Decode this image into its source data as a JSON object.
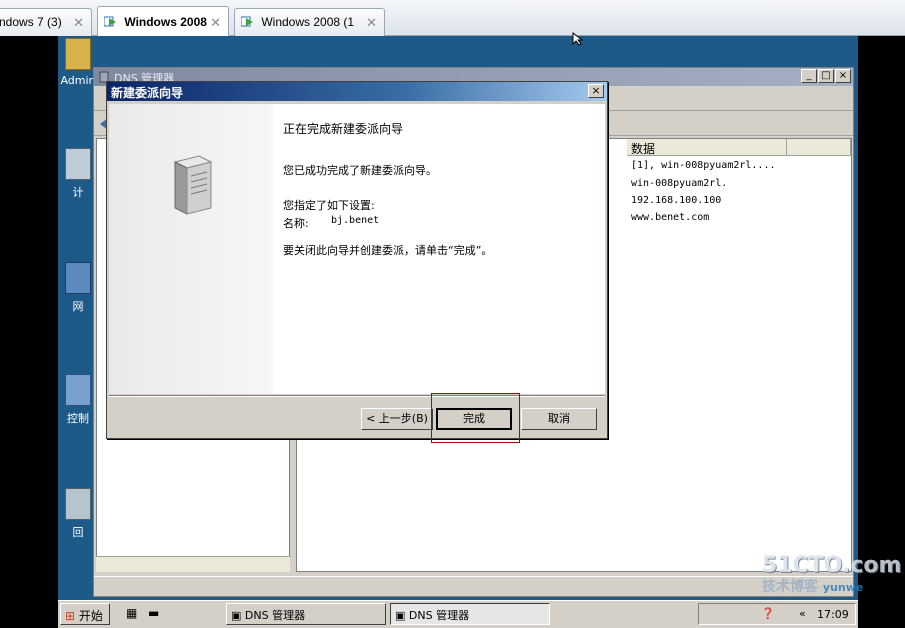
{
  "vm_tabs": [
    {
      "label": "ndows 7 (3)",
      "active": false
    },
    {
      "label": "Windows 2008",
      "active": true
    },
    {
      "label": "Windows 2008 (1",
      "active": false
    }
  ],
  "desktop_icons": [
    {
      "label": "Admin"
    },
    {
      "label": "计"
    },
    {
      "label": "网"
    },
    {
      "label": "控制"
    },
    {
      "label": "回"
    }
  ],
  "dns_window": {
    "title": "DNS 管理器",
    "min": "_",
    "max": "□",
    "close": "×",
    "column_data": "数据",
    "rows": [
      "[1], win-008pyuam2rl....",
      "win-008pyuam2rl.",
      "192.168.100.100",
      "www.benet.com"
    ]
  },
  "wizard": {
    "title": "新建委派向导",
    "close": "×",
    "heading": "正在完成新建委派向导",
    "success": "您已成功完成了新建委派向导。",
    "settings_label": "您指定了如下设置:",
    "name_label": "名称:",
    "name_value": "bj.benet",
    "instruction": "要关闭此向导并创建委派，请单击“完成”。",
    "back_button": "< 上一步(B)",
    "finish_button": "完成",
    "cancel_button": "取消"
  },
  "taskbar": {
    "start": "开始",
    "items": [
      "DNS 管理器",
      "DNS 管理器"
    ],
    "clock": "17:09"
  },
  "watermark": {
    "line1": "51CTO.com",
    "line2": "技术博客",
    "line3": "yunwe"
  },
  "colors": {
    "desktop": "#1d5a88",
    "wizard_title": "#0a246a",
    "highlight": "#c00000"
  }
}
